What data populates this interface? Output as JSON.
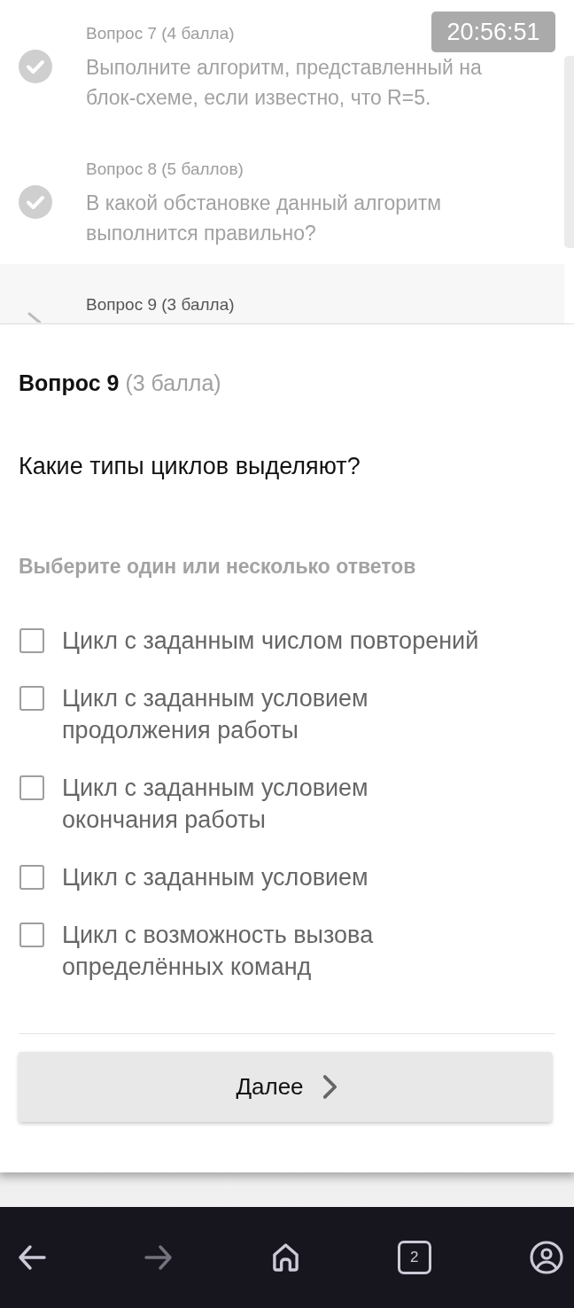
{
  "timer": "20:56:51",
  "question_list": {
    "items": [
      {
        "label": "Вопрос 7 (4 балла)",
        "text": "Выполните алгоритм, представленный на блок-схеме, если известно, что R=5.",
        "answered": true,
        "selected": false
      },
      {
        "label": "Вопрос 8 (5 баллов)",
        "text": "В какой обстановке данный алгоритм выполнится правильно?",
        "answered": true,
        "selected": false
      },
      {
        "label": "Вопрос 9 (3 балла)",
        "answered": false,
        "selected": true
      }
    ]
  },
  "question": {
    "title": "Вопрос 9",
    "points": "(3 балла)",
    "text": "Какие типы циклов выделяют?",
    "instruction": "Выберите один или несколько ответов",
    "options": [
      {
        "label": "Цикл с заданным числом повторений",
        "checked": false
      },
      {
        "label": "Цикл с заданным условием продолжения работы",
        "checked": false
      },
      {
        "label": "Цикл с заданным условием окончания работы",
        "checked": false
      },
      {
        "label": "Цикл с заданным условием",
        "checked": false
      },
      {
        "label": "Цикл с возможность вызова определённых команд",
        "checked": false
      }
    ]
  },
  "next_button": {
    "label": "Далее"
  },
  "nav_bar": [
    {
      "kind": "back",
      "disabled": false
    },
    {
      "kind": "forward",
      "disabled": true
    },
    {
      "kind": "home",
      "disabled": false
    },
    {
      "kind": "tabs",
      "count": "2",
      "disabled": false
    },
    {
      "kind": "profile",
      "disabled": false
    }
  ]
}
